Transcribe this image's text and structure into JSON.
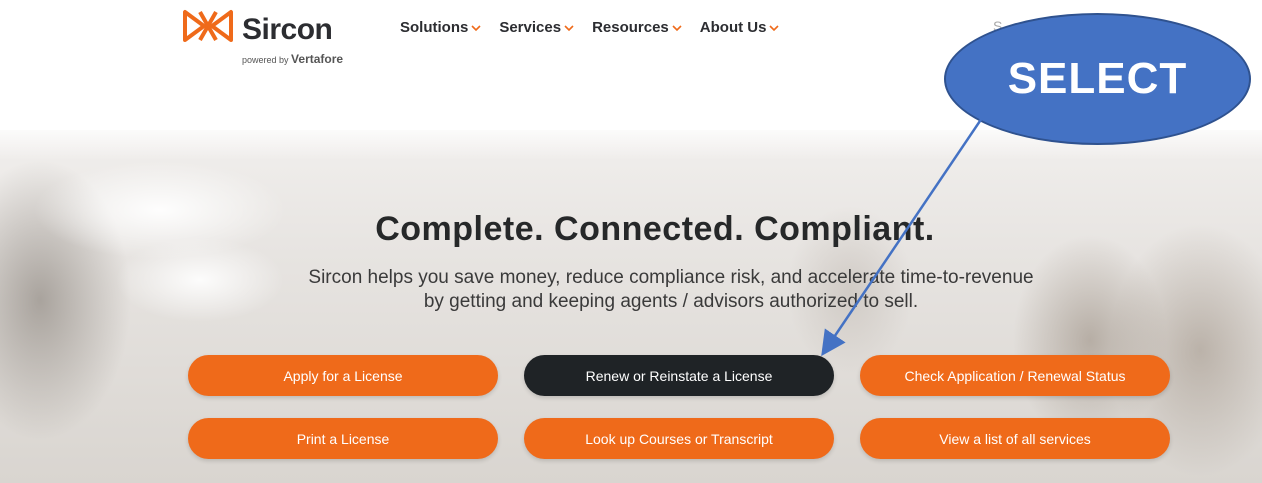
{
  "header": {
    "brand": "Sircon",
    "powered_prefix": "powered by",
    "powered_brand": "Vertafore",
    "nav": [
      {
        "label": "Solutions"
      },
      {
        "label": "Services"
      },
      {
        "label": "Resources"
      },
      {
        "label": "About Us"
      }
    ],
    "search_hint": "S"
  },
  "hero": {
    "headline": "Complete. Connected. Compliant.",
    "subtext_line1": "Sircon helps you save money, reduce compliance risk, and accelerate time-to-revenue",
    "subtext_line2": "by getting and keeping agents / advisors authorized to sell."
  },
  "actions": {
    "apply": "Apply for a License",
    "renew": "Renew or Reinstate a License",
    "check_status": "Check Application / Renewal Status",
    "print": "Print a License",
    "courses": "Look up Courses or Transcript",
    "all_services": "View a list of all services"
  },
  "annotation": {
    "callout_text": "SELECT"
  },
  "colors": {
    "brand_orange": "#ef6a1a",
    "dark_button": "#1f2326",
    "callout_blue": "#4472c4",
    "text_dark": "#2c2d31"
  }
}
